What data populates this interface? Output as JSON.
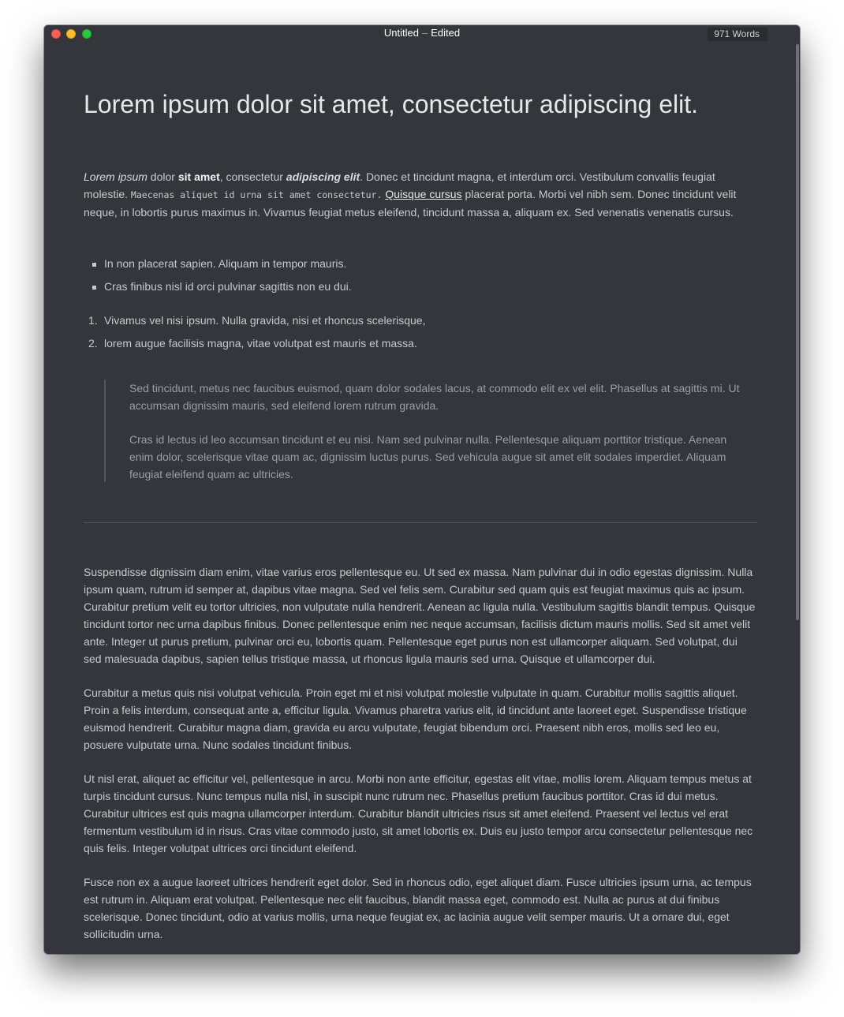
{
  "window": {
    "title": "Untitled",
    "title_separator": "–",
    "title_status": "Edited",
    "word_count": "971 Words"
  },
  "colors": {
    "background": "#34363b",
    "text": "#c7c9cd",
    "heading": "#e6e7ea",
    "quote_text": "#9c9ea3",
    "close": "#fc5f57",
    "minimize": "#fdbc2e",
    "zoom": "#28c840"
  },
  "document": {
    "heading": "Lorem ipsum dolor sit amet, consectetur adipiscing elit.",
    "intro": {
      "em": "Lorem ipsum",
      "t1": " dolor ",
      "strong": "sit amet",
      "t2": ", consectetur ",
      "strong_em": "adipiscing elit",
      "t3": ". Donec et tincidunt magna, et interdum orci. Vestibulum convallis feugiat molestie. ",
      "code": "Maecenas aliquet id urna sit amet consectetur.",
      "t4": " ",
      "link": "Quisque cursus",
      "t5": " placerat porta. Morbi vel nibh sem. Donec tincidunt velit neque, in lobortis purus maximus in. Vivamus feugiat metus eleifend, tincidunt massa a, aliquam ex. Sed venenatis venenatis cursus."
    },
    "bullets": [
      "In non placerat sapien. Aliquam in tempor mauris.",
      "Cras finibus nisl id orci pulvinar sagittis non eu dui."
    ],
    "numbered": [
      {
        "num": "1.",
        "text": "Vivamus vel nisi ipsum. Nulla gravida, nisi et rhoncus scelerisque,"
      },
      {
        "num": "2.",
        "text": "lorem augue facilisis magna, vitae volutpat est mauris et massa."
      }
    ],
    "quote": [
      "Sed tincidunt, metus nec faucibus euismod, quam dolor sodales lacus, at commodo elit ex vel elit. Phasellus at sagittis mi. Ut accumsan dignissim mauris, sed eleifend lorem rutrum gravida.",
      "Cras id lectus id leo accumsan tincidunt et eu nisi. Nam sed pulvinar nulla. Pellentesque aliquam porttitor tristique. Aenean enim dolor, scelerisque vitae quam ac, dignissim luctus purus. Sed vehicula augue sit amet elit sodales imperdiet. Aliquam feugiat eleifend quam ac ultricies."
    ],
    "paragraphs": [
      "Suspendisse dignissim diam enim, vitae varius eros pellentesque eu. Ut sed ex massa. Nam pulvinar dui in odio egestas dignissim. Nulla ipsum quam, rutrum id semper at, dapibus vitae magna. Sed vel felis sem. Curabitur sed quam quis est feugiat maximus quis ac ipsum. Curabitur pretium velit eu tortor ultricies, non vulputate nulla hendrerit. Aenean ac ligula nulla. Vestibulum sagittis blandit tempus. Quisque tincidunt tortor nec urna dapibus finibus. Donec pellentesque enim nec neque accumsan, facilisis dictum mauris mollis. Sed sit amet velit ante. Integer ut purus pretium, pulvinar orci eu, lobortis quam. Pellentesque eget purus non est ullamcorper aliquam. Sed volutpat, dui sed malesuada dapibus, sapien tellus tristique massa, ut rhoncus ligula mauris sed urna. Quisque et ullamcorper dui.",
      "Curabitur a metus quis nisi volutpat vehicula. Proin eget mi et nisi volutpat molestie vulputate in quam. Curabitur mollis sagittis aliquet. Proin a felis interdum, consequat ante a, efficitur ligula. Vivamus pharetra varius elit, id tincidunt ante laoreet eget. Suspendisse tristique euismod hendrerit. Curabitur magna diam, gravida eu arcu vulputate, feugiat bibendum orci. Praesent nibh eros, mollis sed leo eu, posuere vulputate urna. Nunc sodales tincidunt finibus.",
      "Ut nisl erat, aliquet ac efficitur vel, pellentesque in arcu. Morbi non ante efficitur, egestas elit vitae, mollis lorem. Aliquam tempus metus at turpis tincidunt cursus. Nunc tempus nulla nisl, in suscipit nunc rutrum nec. Phasellus pretium faucibus porttitor. Cras id dui metus. Curabitur ultrices est quis magna ullamcorper interdum. Curabitur blandit ultricies risus sit amet eleifend. Praesent vel lectus vel erat fermentum vestibulum id in risus. Cras vitae commodo justo, sit amet lobortis ex. Duis eu justo tempor arcu consectetur pellentesque nec quis felis. Integer volutpat ultrices orci tincidunt eleifend.",
      "Fusce non ex a augue laoreet ultrices hendrerit eget dolor. Sed in rhoncus odio, eget aliquet diam. Fusce ultricies ipsum urna, ac tempus est rutrum in. Aliquam erat volutpat. Pellentesque nec elit faucibus, blandit massa eget, commodo est. Nulla ac purus at dui finibus scelerisque. Donec tincidunt, odio at varius mollis, urna neque feugiat ex, ac lacinia augue velit semper mauris. Ut a ornare dui, eget sollicitudin urna."
    ]
  }
}
